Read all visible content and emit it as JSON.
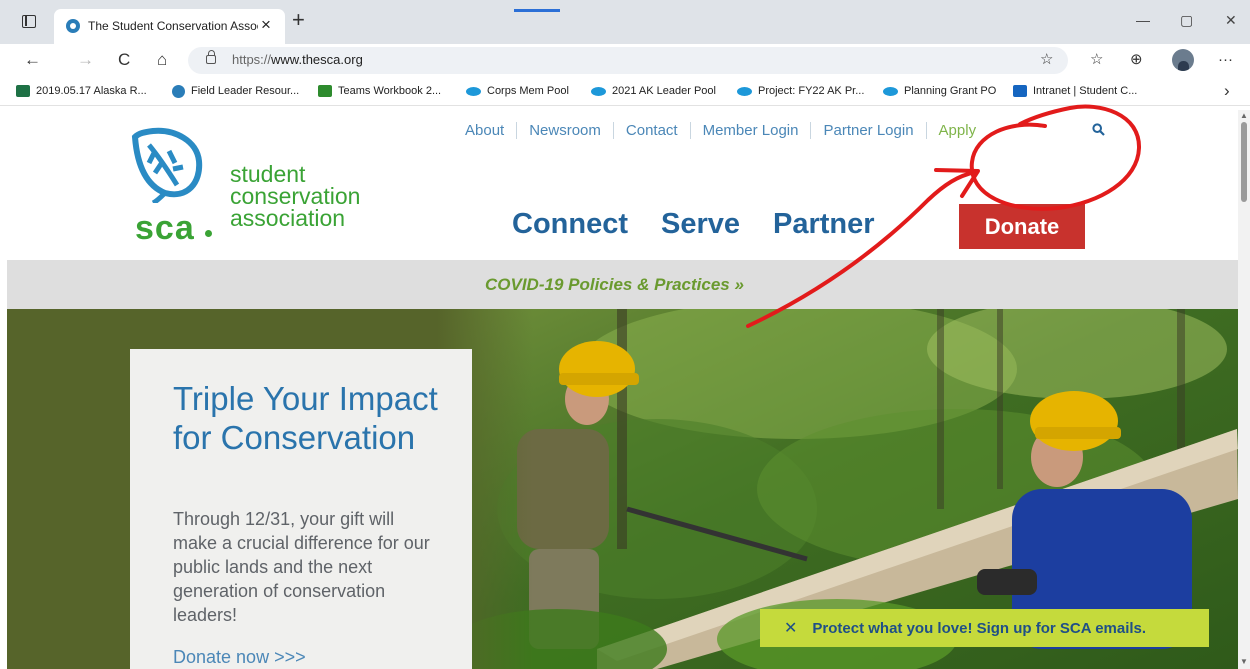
{
  "browser": {
    "tab": {
      "title": "The Student Conservation Association",
      "close": "×"
    },
    "new_tab": "+",
    "window": {
      "minimize": "—",
      "restore": "▢",
      "close": "✕"
    },
    "nav": {
      "back": "←",
      "forward": "→",
      "refresh": "C",
      "home": "⌂"
    },
    "address": {
      "scheme": "https://",
      "host": "www.thesca.org"
    },
    "tools": {
      "favorite": "☆",
      "favorites": "☆",
      "collections": "⊕",
      "more": "···"
    },
    "bookmarks": [
      {
        "label": "2019.05.17 Alaska R...",
        "icon": "excel-icon",
        "cls": "xl"
      },
      {
        "label": "Field Leader Resour...",
        "icon": "sca-favicon-icon",
        "cls": "sca"
      },
      {
        "label": "Teams Workbook 2...",
        "icon": "teams-icon",
        "cls": "teams"
      },
      {
        "label": "Corps Mem Pool",
        "icon": "salesforce-icon",
        "cls": "sf"
      },
      {
        "label": "2021 AK Leader Pool",
        "icon": "salesforce-icon",
        "cls": "sf"
      },
      {
        "label": "Project: FY22 AK Pr...",
        "icon": "salesforce-icon",
        "cls": "sf"
      },
      {
        "label": "Planning Grant PO",
        "icon": "salesforce-icon",
        "cls": "sf"
      },
      {
        "label": "Intranet | Student C...",
        "icon": "sharepoint-icon",
        "cls": "ms"
      }
    ],
    "bookmarks_more": "›"
  },
  "site": {
    "logo": {
      "mark": "sca",
      "line1": "student",
      "line2": "conservation",
      "line3": "association"
    },
    "utility_nav": [
      "About",
      "Newsroom",
      "Contact",
      "Member Login",
      "Partner Login",
      "Apply"
    ],
    "main_nav": [
      "Connect",
      "Serve",
      "Partner"
    ],
    "donate": "Donate",
    "covid": "COVID-19 Policies & Practices »"
  },
  "hero": {
    "title": "Triple Your Impact for Conservation",
    "body": "Through 12/31, your gift will make a crucial difference for our public lands and the next generation of conservation leaders!",
    "cta": "Donate now >>>",
    "email_close": "✕",
    "email_signup": "Protect what you love! Sign up for SCA emails."
  },
  "colors": {
    "brand_green": "#3aa335",
    "nav_blue": "#23639a",
    "donate_red": "#c8322d",
    "annotation_red": "#e21b1b",
    "email_bar": "#c5da3c"
  }
}
